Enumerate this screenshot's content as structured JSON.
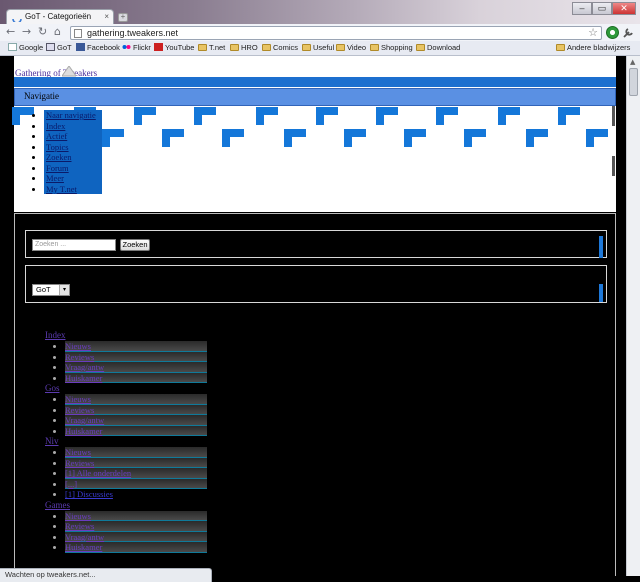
{
  "browser": {
    "tab_title": "GoT - Categorieën",
    "tab_close": "×",
    "new_tab": "+",
    "window_buttons": [
      "–",
      "▭",
      "✕"
    ],
    "nav_buttons": [
      "←",
      "→",
      "↻",
      "⌂"
    ],
    "url": "gathering.tweakers.net",
    "star": "☆",
    "bookmarks": [
      {
        "label": "Google",
        "icon": "google-icon",
        "kind": "g"
      },
      {
        "label": "GoT",
        "icon": "got-icon",
        "kind": "got"
      },
      {
        "label": "Facebook",
        "icon": "facebook-icon",
        "kind": "fb"
      },
      {
        "label": "Flickr",
        "icon": "flickr-icon",
        "kind": "fl"
      },
      {
        "label": "YouTube",
        "icon": "youtube-icon",
        "kind": "yt"
      },
      {
        "label": "T.net",
        "icon": "folder-icon",
        "kind": "fold"
      },
      {
        "label": "HRO",
        "icon": "folder-icon",
        "kind": "fold"
      },
      {
        "label": "Comics",
        "icon": "folder-icon",
        "kind": "fold"
      },
      {
        "label": "Useful",
        "icon": "folder-icon",
        "kind": "fold"
      },
      {
        "label": "Video",
        "icon": "folder-icon",
        "kind": "fold"
      },
      {
        "label": "Shopping",
        "icon": "folder-icon",
        "kind": "fold"
      },
      {
        "label": "Download",
        "icon": "folder-icon",
        "kind": "fold"
      }
    ],
    "other_bookmarks": "Andere bladwijzers",
    "status": "Wachten op tweakers.net..."
  },
  "page": {
    "site_link": "Gathering of Tweakers",
    "nav_heading": "Navigatie",
    "nav_items": [
      "Naar navigatie",
      "Index",
      "Actief",
      "Topics",
      "Zoeken",
      "Forum",
      "Meer",
      "My T.net"
    ],
    "search": {
      "placeholder": "Zoeken ...",
      "button": "Zoeken"
    },
    "site_select": {
      "value": "GoT",
      "arrow": "▾"
    },
    "forums": [
      {
        "category": "Index",
        "items": [
          "Nieuws",
          "Reviews",
          "Vraag/antw",
          "Huiskamer"
        ]
      },
      {
        "category": "Gos",
        "items": [
          "Nieuws",
          "Reviews",
          "Vraag/antw",
          "Huiskamer"
        ]
      },
      {
        "category": "Niv",
        "items": [
          "Nieuws",
          "Reviews",
          "[1] Alle onderdelen",
          "[...]",
          "[1] Discussies"
        ]
      },
      {
        "category": "Games",
        "items": [
          "Nieuws",
          "Reviews",
          "Vraag/antw",
          "Huiskamer"
        ]
      }
    ]
  }
}
